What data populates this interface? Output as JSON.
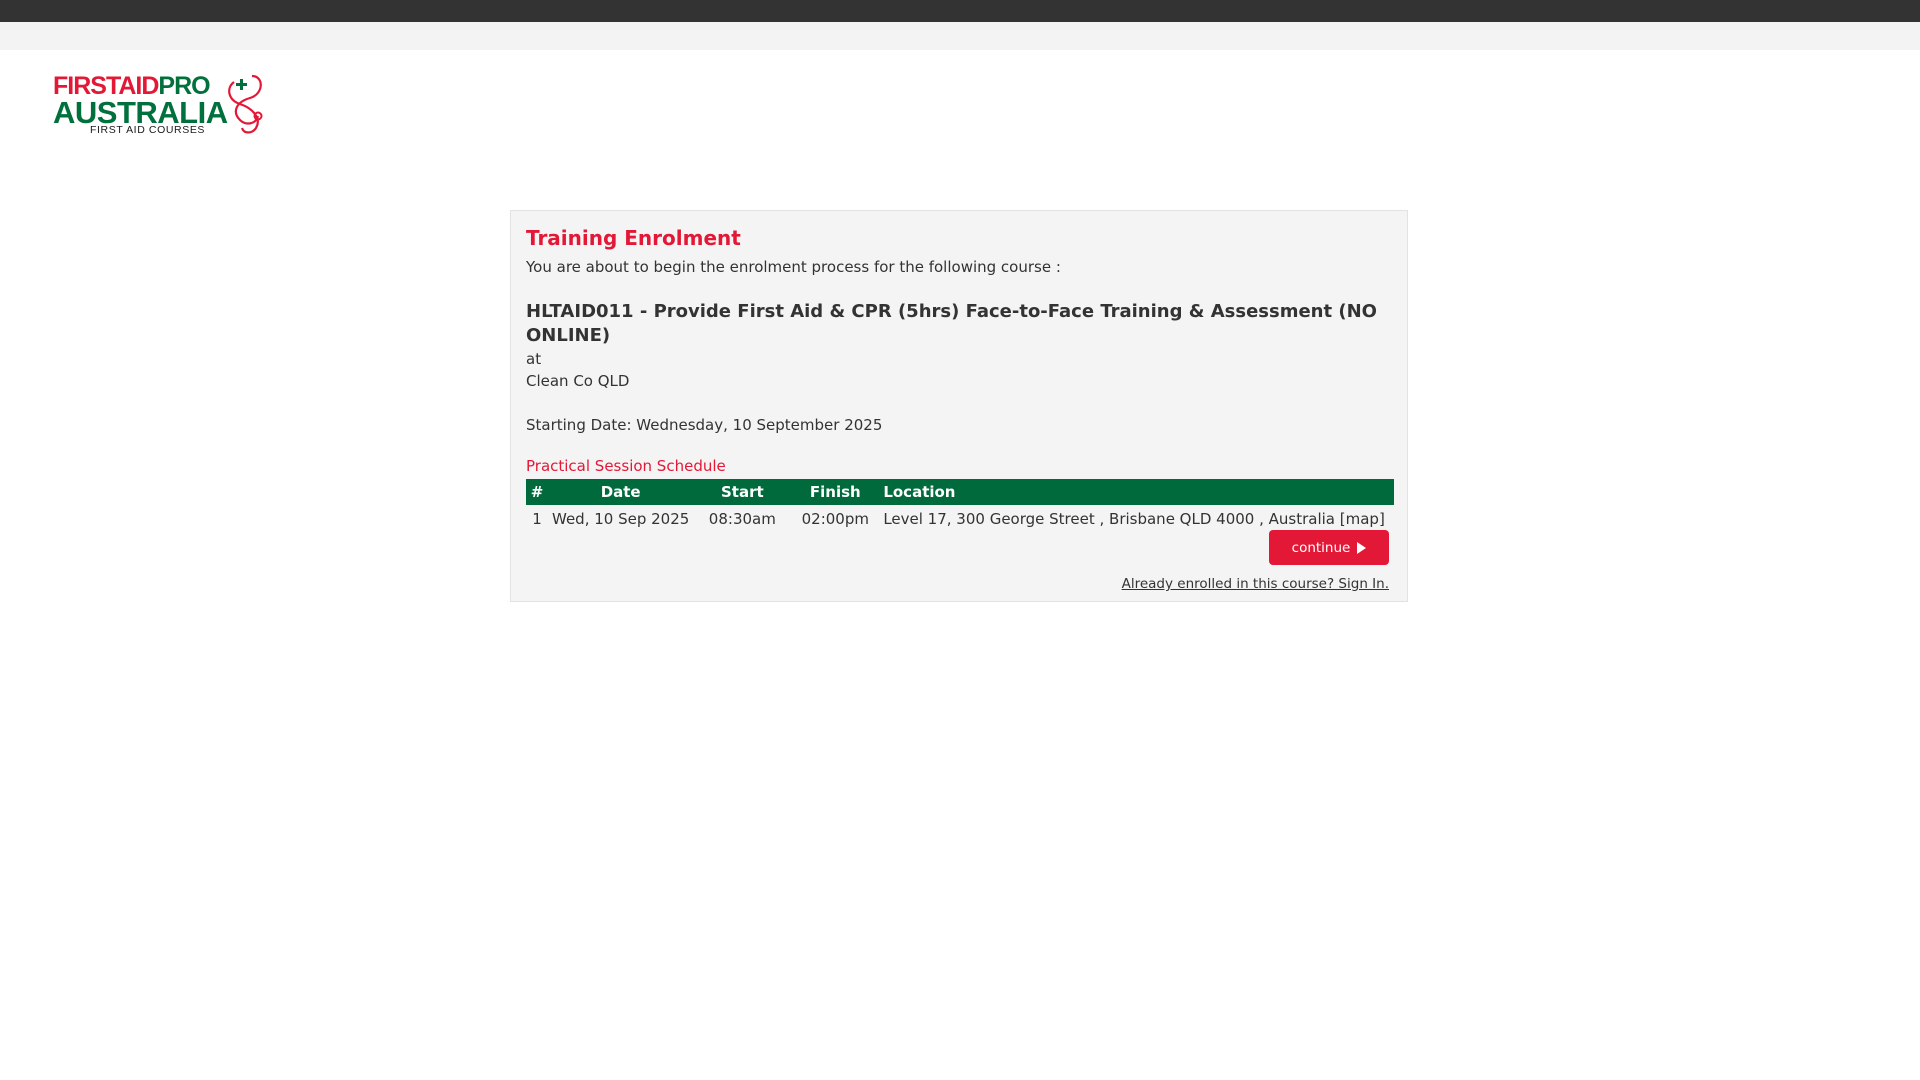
{
  "logo": {
    "line1_first": "FIRSTAID",
    "line1_second": "PRO",
    "line2": "AUSTRALIA",
    "line3": "FIRST AID COURSES",
    "brand_red": "#e31837",
    "brand_green": "#00703c"
  },
  "enrolment": {
    "title": "Training Enrolment",
    "intro": "You are about to begin the enrolment process for the following course :",
    "course_name": "HLTAID011 - Provide First Aid & CPR (5hrs) Face-to-Face Training & Assessment (NO ONLINE)",
    "at_label": "at",
    "venue": "Clean Co QLD",
    "starting_date": "Starting Date: Wednesday, 10 September 2025"
  },
  "schedule": {
    "title": "Practical Session Schedule",
    "headers": {
      "num": "#",
      "date": "Date",
      "start": "Start",
      "finish": "Finish",
      "location": "Location"
    },
    "rows": [
      {
        "num": "1",
        "date": "Wed, 10 Sep 2025",
        "start": "08:30am",
        "finish": "02:00pm",
        "location": "Level 17, 300 George Street , Brisbane QLD 4000 , Australia",
        "map_link": "[map]"
      }
    ],
    "header_color": "#006a3c"
  },
  "actions": {
    "continue_label": "continue",
    "continue_icon": "play-icon",
    "signin_text": "Already enrolled in this course? Sign In."
  }
}
